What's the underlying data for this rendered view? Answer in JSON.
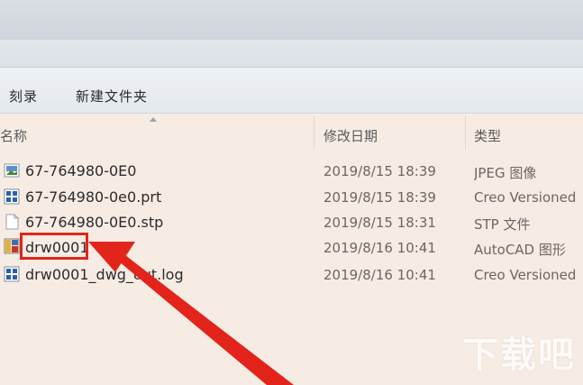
{
  "toolbar": {
    "burn_label": "刻录",
    "new_folder_label": "新建文件夹"
  },
  "columns": {
    "name": "名称",
    "date_modified": "修改日期",
    "type": "类型"
  },
  "files": [
    {
      "name": "67-764980-0E0",
      "date": "2019/8/15 18:39",
      "type": "JPEG 图像",
      "icon": "jpeg-image-icon"
    },
    {
      "name": "67-764980-0e0.prt",
      "date": "2019/8/15 18:39",
      "type": "Creo Versioned",
      "icon": "creo-part-icon"
    },
    {
      "name": "67-764980-0E0.stp",
      "date": "2019/8/15 18:31",
      "type": "STP 文件",
      "icon": "generic-file-icon"
    },
    {
      "name": "drw0001",
      "date": "2019/8/16 10:41",
      "type": "AutoCAD 图形",
      "icon": "autocad-drawing-icon"
    },
    {
      "name": "drw0001_dwg_out.log",
      "date": "2019/8/16 10:41",
      "type": "Creo Versioned",
      "icon": "creo-log-icon"
    }
  ],
  "colors": {
    "highlight": "#e3241b",
    "background": "#f7ece4"
  },
  "watermark": "下载吧"
}
